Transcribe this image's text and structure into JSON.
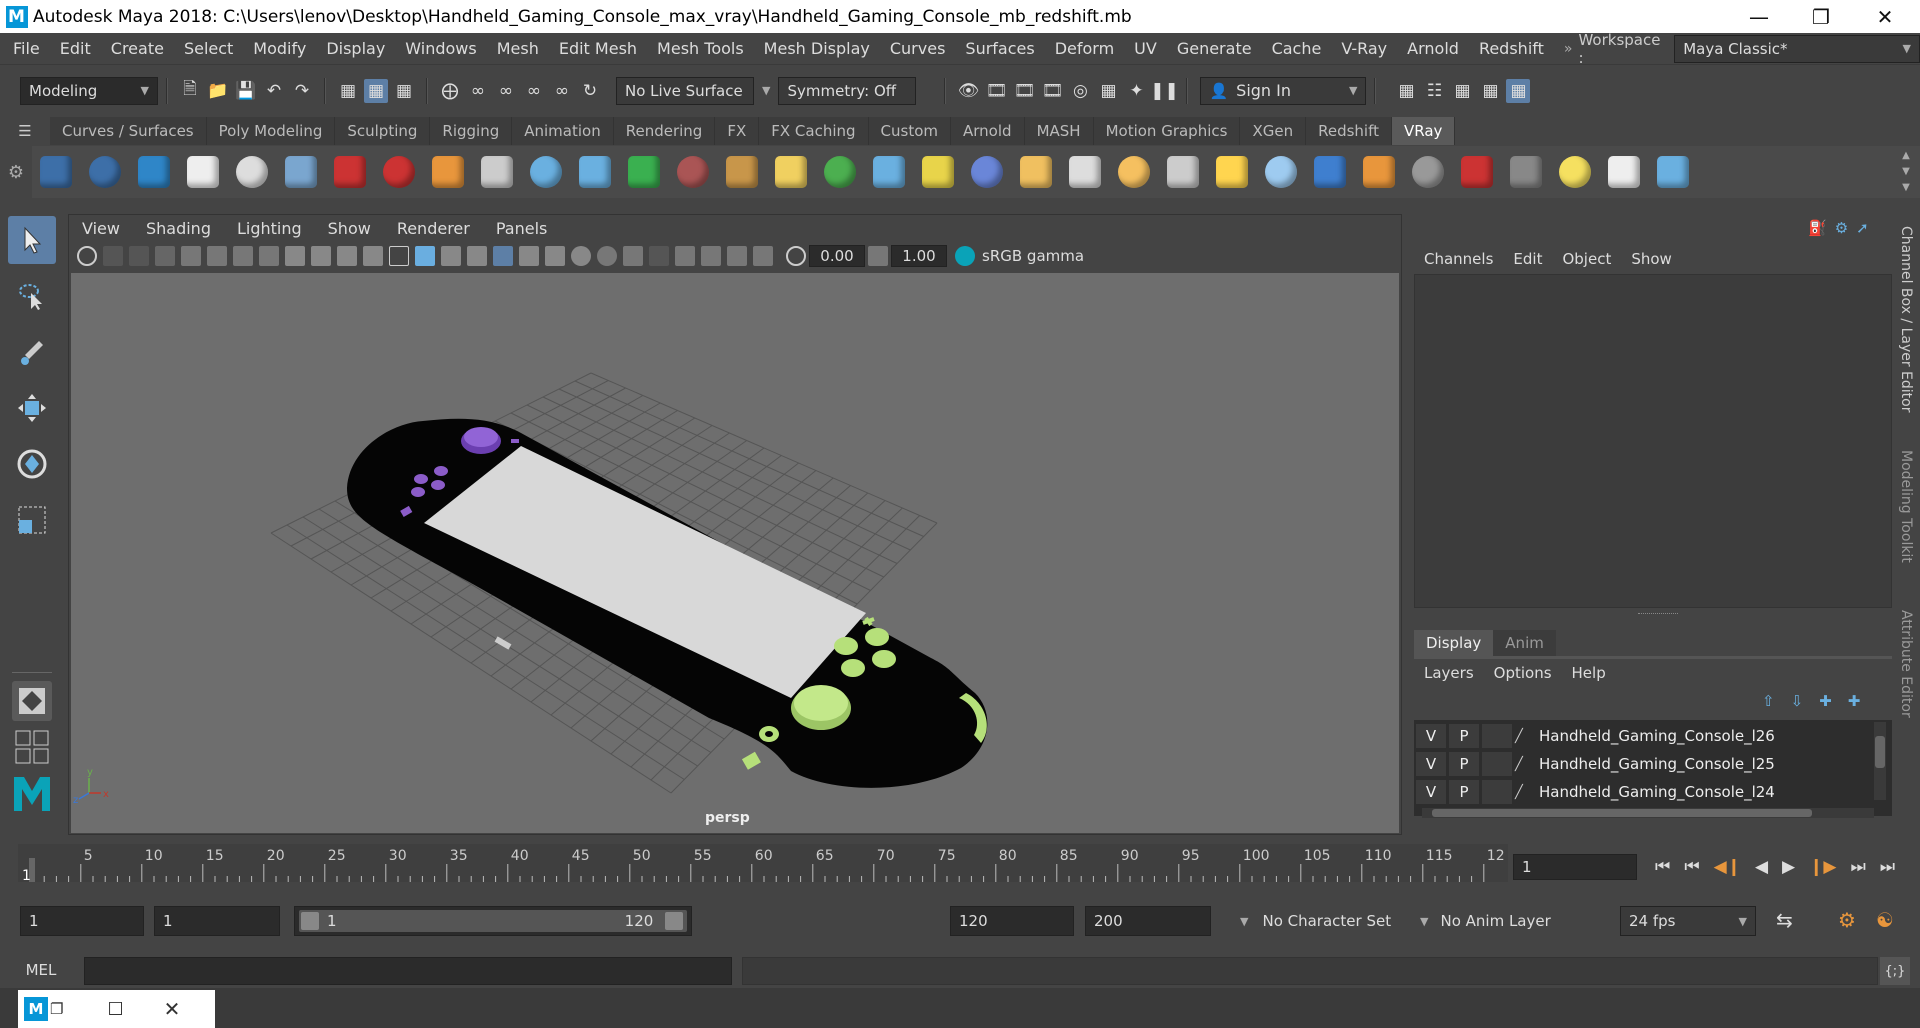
{
  "window": {
    "title": "Autodesk Maya 2018: C:\\Users\\lenov\\Desktop\\Handheld_Gaming_Console_max_vray\\Handheld_Gaming_Console_mb_redshift.mb",
    "logo": "M"
  },
  "menu": [
    "File",
    "Edit",
    "Create",
    "Select",
    "Modify",
    "Display",
    "Windows",
    "Mesh",
    "Edit Mesh",
    "Mesh Tools",
    "Mesh Display",
    "Curves",
    "Surfaces",
    "Deform",
    "UV",
    "Generate",
    "Cache",
    "V-Ray",
    "Arnold",
    "Redshift"
  ],
  "workspace": {
    "label": "Workspace :",
    "value": "Maya Classic*"
  },
  "status": {
    "mode": "Modeling",
    "live_surface": "No Live Surface",
    "symmetry": "Symmetry: Off",
    "sign_in": "Sign In"
  },
  "shelf_tabs": [
    "Curves / Surfaces",
    "Poly Modeling",
    "Sculpting",
    "Rigging",
    "Animation",
    "Rendering",
    "FX",
    "FX Caching",
    "Custom",
    "Arnold",
    "MASH",
    "Motion Graphics",
    "XGen",
    "Redshift",
    "VRay"
  ],
  "active_shelf": "VRay",
  "viewport": {
    "menus": [
      "View",
      "Shading",
      "Lighting",
      "Show",
      "Renderer",
      "Panels"
    ],
    "exposure": "0.00",
    "gamma": "1.00",
    "color_space": "sRGB gamma",
    "camera": "persp"
  },
  "channel_box": {
    "menus": [
      "Channels",
      "Edit",
      "Object",
      "Show"
    ]
  },
  "layer_editor": {
    "tabs": [
      "Display",
      "Anim"
    ],
    "menus": [
      "Layers",
      "Options",
      "Help"
    ],
    "layers": [
      {
        "v": "V",
        "p": "P",
        "name": "Handheld_Gaming_Console_l26"
      },
      {
        "v": "V",
        "p": "P",
        "name": "Handheld_Gaming_Console_l25"
      },
      {
        "v": "V",
        "p": "P",
        "name": "Handheld_Gaming_Console_l24"
      }
    ]
  },
  "side_tabs": [
    "Channel Box / Layer Editor",
    "Modeling Toolkit",
    "Attribute Editor"
  ],
  "timeline": {
    "ticks": [
      "5",
      "10",
      "15",
      "20",
      "25",
      "30",
      "35",
      "40",
      "45",
      "50",
      "55",
      "60",
      "65",
      "70",
      "75",
      "80",
      "85",
      "90",
      "95",
      "100",
      "105",
      "110",
      "115",
      "12"
    ],
    "start_label": "1",
    "current_frame": "1"
  },
  "range": {
    "start": "1",
    "playback_start": "1",
    "slider_start": "1",
    "slider_end": "120",
    "playback_end": "120",
    "end": "200",
    "character_set": "No Character Set",
    "anim_layer": "No Anim Layer",
    "fps": "24 fps"
  },
  "command": {
    "lang": "MEL"
  },
  "colors": {
    "accent_blue": "#5d7fa6",
    "purple_buttons": "#8b5cc8",
    "green_buttons": "#b6e07a",
    "screen": "#d6d6d6"
  }
}
